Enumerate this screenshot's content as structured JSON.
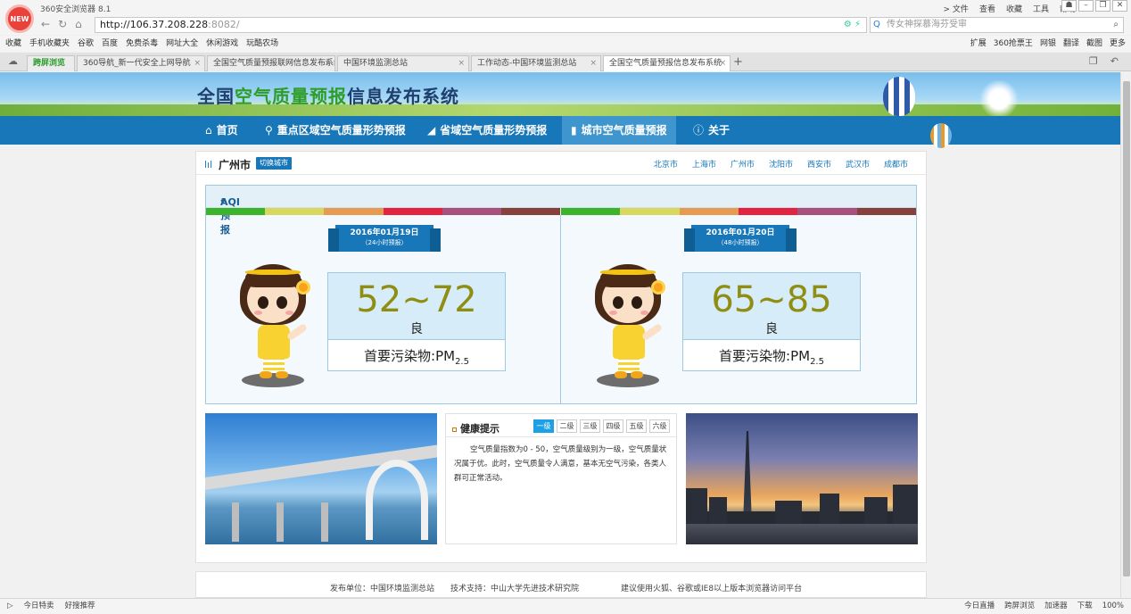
{
  "browser": {
    "logo": "NEW",
    "app_title": "360安全浏览器 8.1",
    "top_menu": [
      "> 文件",
      "查看",
      "收藏",
      "工具",
      "帮助"
    ],
    "window_controls": [
      "shirt-icon",
      "minimize-icon",
      "restore-icon",
      "close-icon"
    ],
    "url_host": "http://106.37.208.228",
    "url_port": ":8082/",
    "search_placeholder": "传女神探慕海芬受审",
    "bookmarks": [
      "收藏",
      "手机收藏夹",
      "谷歌",
      "百度",
      "免费杀毒",
      "网址大全",
      "休闲游戏",
      "玩酷农场"
    ],
    "bookmark_tools": [
      "扩展",
      "360抢票王",
      "网银",
      "翻译",
      "截图",
      "更多"
    ],
    "tabs": [
      {
        "label": "跨屏浏览"
      },
      {
        "label": "360导航_新一代安全上网导航"
      },
      {
        "label": "全国空气质量预报联网信息发布系统"
      },
      {
        "label": "中国环境监测总站"
      },
      {
        "label": "工作动态-中国环境监测总站"
      },
      {
        "label": "全国空气质量预报信息发布系统"
      }
    ]
  },
  "site": {
    "title_a": "全国",
    "title_b": "空气质量预报",
    "title_c": "信息发布系统",
    "nav": [
      "首页",
      "重点区域空气质量形势预报",
      "省域空气质量形势预报",
      "城市空气质量预报",
      "关于"
    ],
    "nav_icons": [
      "home-icon",
      "map-marker-icon",
      "area-chart-icon",
      "bar-chart-icon",
      "info-icon"
    ]
  },
  "city": {
    "current": "广州市",
    "switch_label": "切换城市",
    "quick": [
      "北京市",
      "上海市",
      "广州市",
      "沈阳市",
      "西安市",
      "武汉市",
      "成都市"
    ]
  },
  "aqi": {
    "heading": "AQI预报",
    "level_colors": [
      "#3bb32a",
      "#d8d860",
      "#e79a52",
      "#e32440",
      "#a7527d",
      "#86413c"
    ],
    "forecasts": [
      {
        "date": "2016年01月19日",
        "period": "（24小时预报）",
        "range": "52~72",
        "level": "良",
        "pollutant": "首要污染物:PM",
        "sub": "2.5"
      },
      {
        "date": "2016年01月20日",
        "period": "（48小时预报）",
        "range": "65~85",
        "level": "良",
        "pollutant": "首要污染物:PM",
        "sub": "2.5"
      }
    ]
  },
  "health": {
    "title": "健康提示",
    "levels": [
      "一级",
      "二级",
      "三级",
      "四级",
      "五级",
      "六级"
    ],
    "selected": "一级",
    "text": "空气质量指数为0 - 50，空气质量级别为一级，空气质量状况属于优。此时，空气质量令人满意，基本无空气污染，各类人群可正常活动。"
  },
  "footer": {
    "publisher": "发布单位：中国环境监测总站",
    "support": "技术支持：中山大学先进技术研究院",
    "advice": "建议使用火狐、谷歌或IE8以上版本浏览器访问平台"
  },
  "statusbar": {
    "left": [
      "今日特卖",
      "好搜推荐"
    ],
    "right": [
      "今日直播",
      "跨屏浏览",
      "加速器",
      "下载",
      "100%"
    ]
  }
}
